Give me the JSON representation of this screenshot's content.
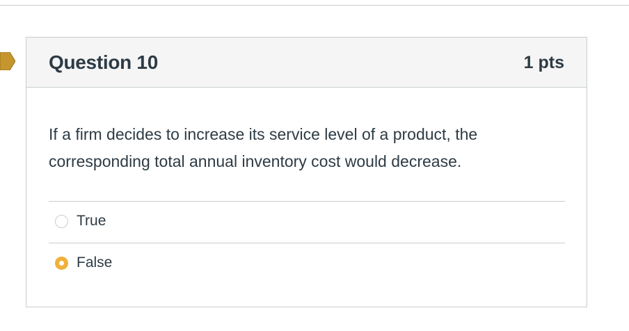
{
  "question": {
    "title": "Question 10",
    "points": "1 pts",
    "text": "If a firm decides to increase its service level of a product, the corresponding total annual inventory cost would decrease.",
    "flag_color": "#c5962d"
  },
  "answers": [
    {
      "label": "True",
      "selected": false
    },
    {
      "label": "False",
      "selected": true
    }
  ],
  "colors": {
    "selected_radio": "#f0b03a",
    "text": "#2d3b45",
    "header_bg": "#f5f5f5",
    "border": "#c7cdd1"
  }
}
